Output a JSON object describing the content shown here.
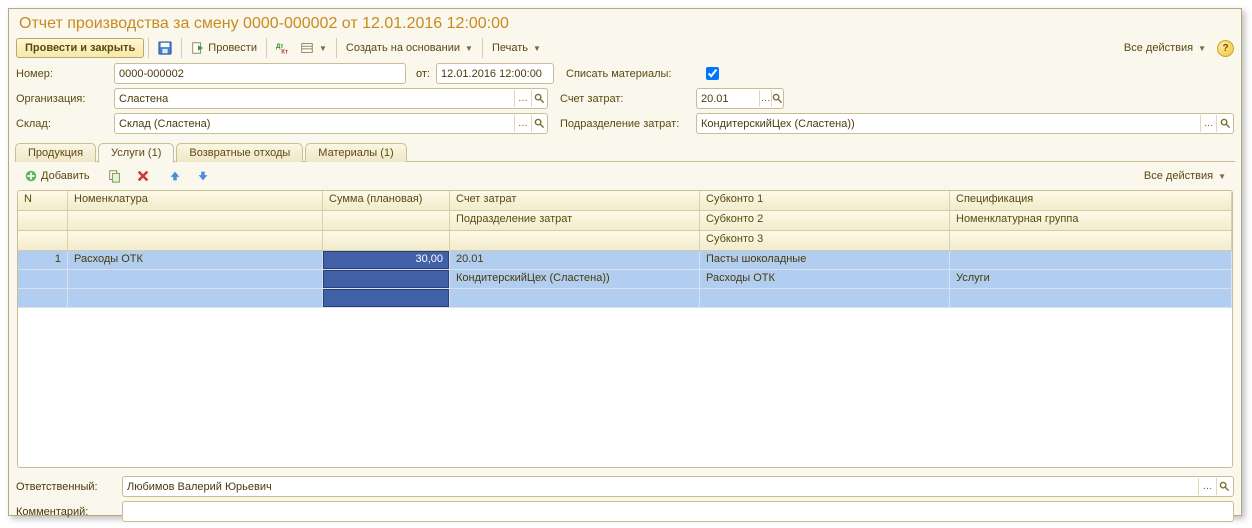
{
  "title": "Отчет производства за смену 0000-000002 от 12.01.2016 12:00:00",
  "toolbar": {
    "post_close": "Провести и закрыть",
    "post": "Провести",
    "create_based": "Создать на основании",
    "print": "Печать",
    "all_actions": "Все действия"
  },
  "form": {
    "number_lbl": "Номер:",
    "number": "0000-000002",
    "date_lbl": "от:",
    "date": "12.01.2016 12:00:00",
    "writeoff_lbl": "Списать материалы:",
    "org_lbl": "Организация:",
    "org": "Сластена",
    "cost_acct_lbl": "Счет затрат:",
    "cost_acct": "20.01",
    "warehouse_lbl": "Склад:",
    "warehouse": "Склад (Сластена)",
    "dept_lbl": "Подразделение затрат:",
    "dept": "КондитерскийЦех (Сластена))"
  },
  "tabs": {
    "products": "Продукция",
    "services": "Услуги (1)",
    "returns": "Возвратные отходы",
    "materials": "Материалы (1)"
  },
  "tab_toolbar": {
    "add": "Добавить",
    "all_actions": "Все действия"
  },
  "columns": {
    "n": "N",
    "nomen": "Номенклатура",
    "sum": "Сумма (плановая)",
    "account": "Счет затрат",
    "dept": "Подразделение затрат",
    "sub1": "Субконто 1",
    "sub2": "Субконто 2",
    "sub3": "Субконто 3",
    "spec": "Спецификация",
    "nomgroup": "Номенклатурная группа"
  },
  "rows": [
    {
      "n": "1",
      "nomen": "Расходы ОТК",
      "sum": "30,00",
      "account": "20.01",
      "dept": "КондитерскийЦех (Сластена))",
      "sub1": "Пасты шоколадные",
      "sub2": "Расходы ОТК",
      "sub3": "",
      "spec": "",
      "nomgroup": "Услуги"
    }
  ],
  "footer": {
    "resp_lbl": "Ответственный:",
    "resp": "Любимов Валерий Юрьевич",
    "comment_lbl": "Комментарий:",
    "comment": ""
  }
}
